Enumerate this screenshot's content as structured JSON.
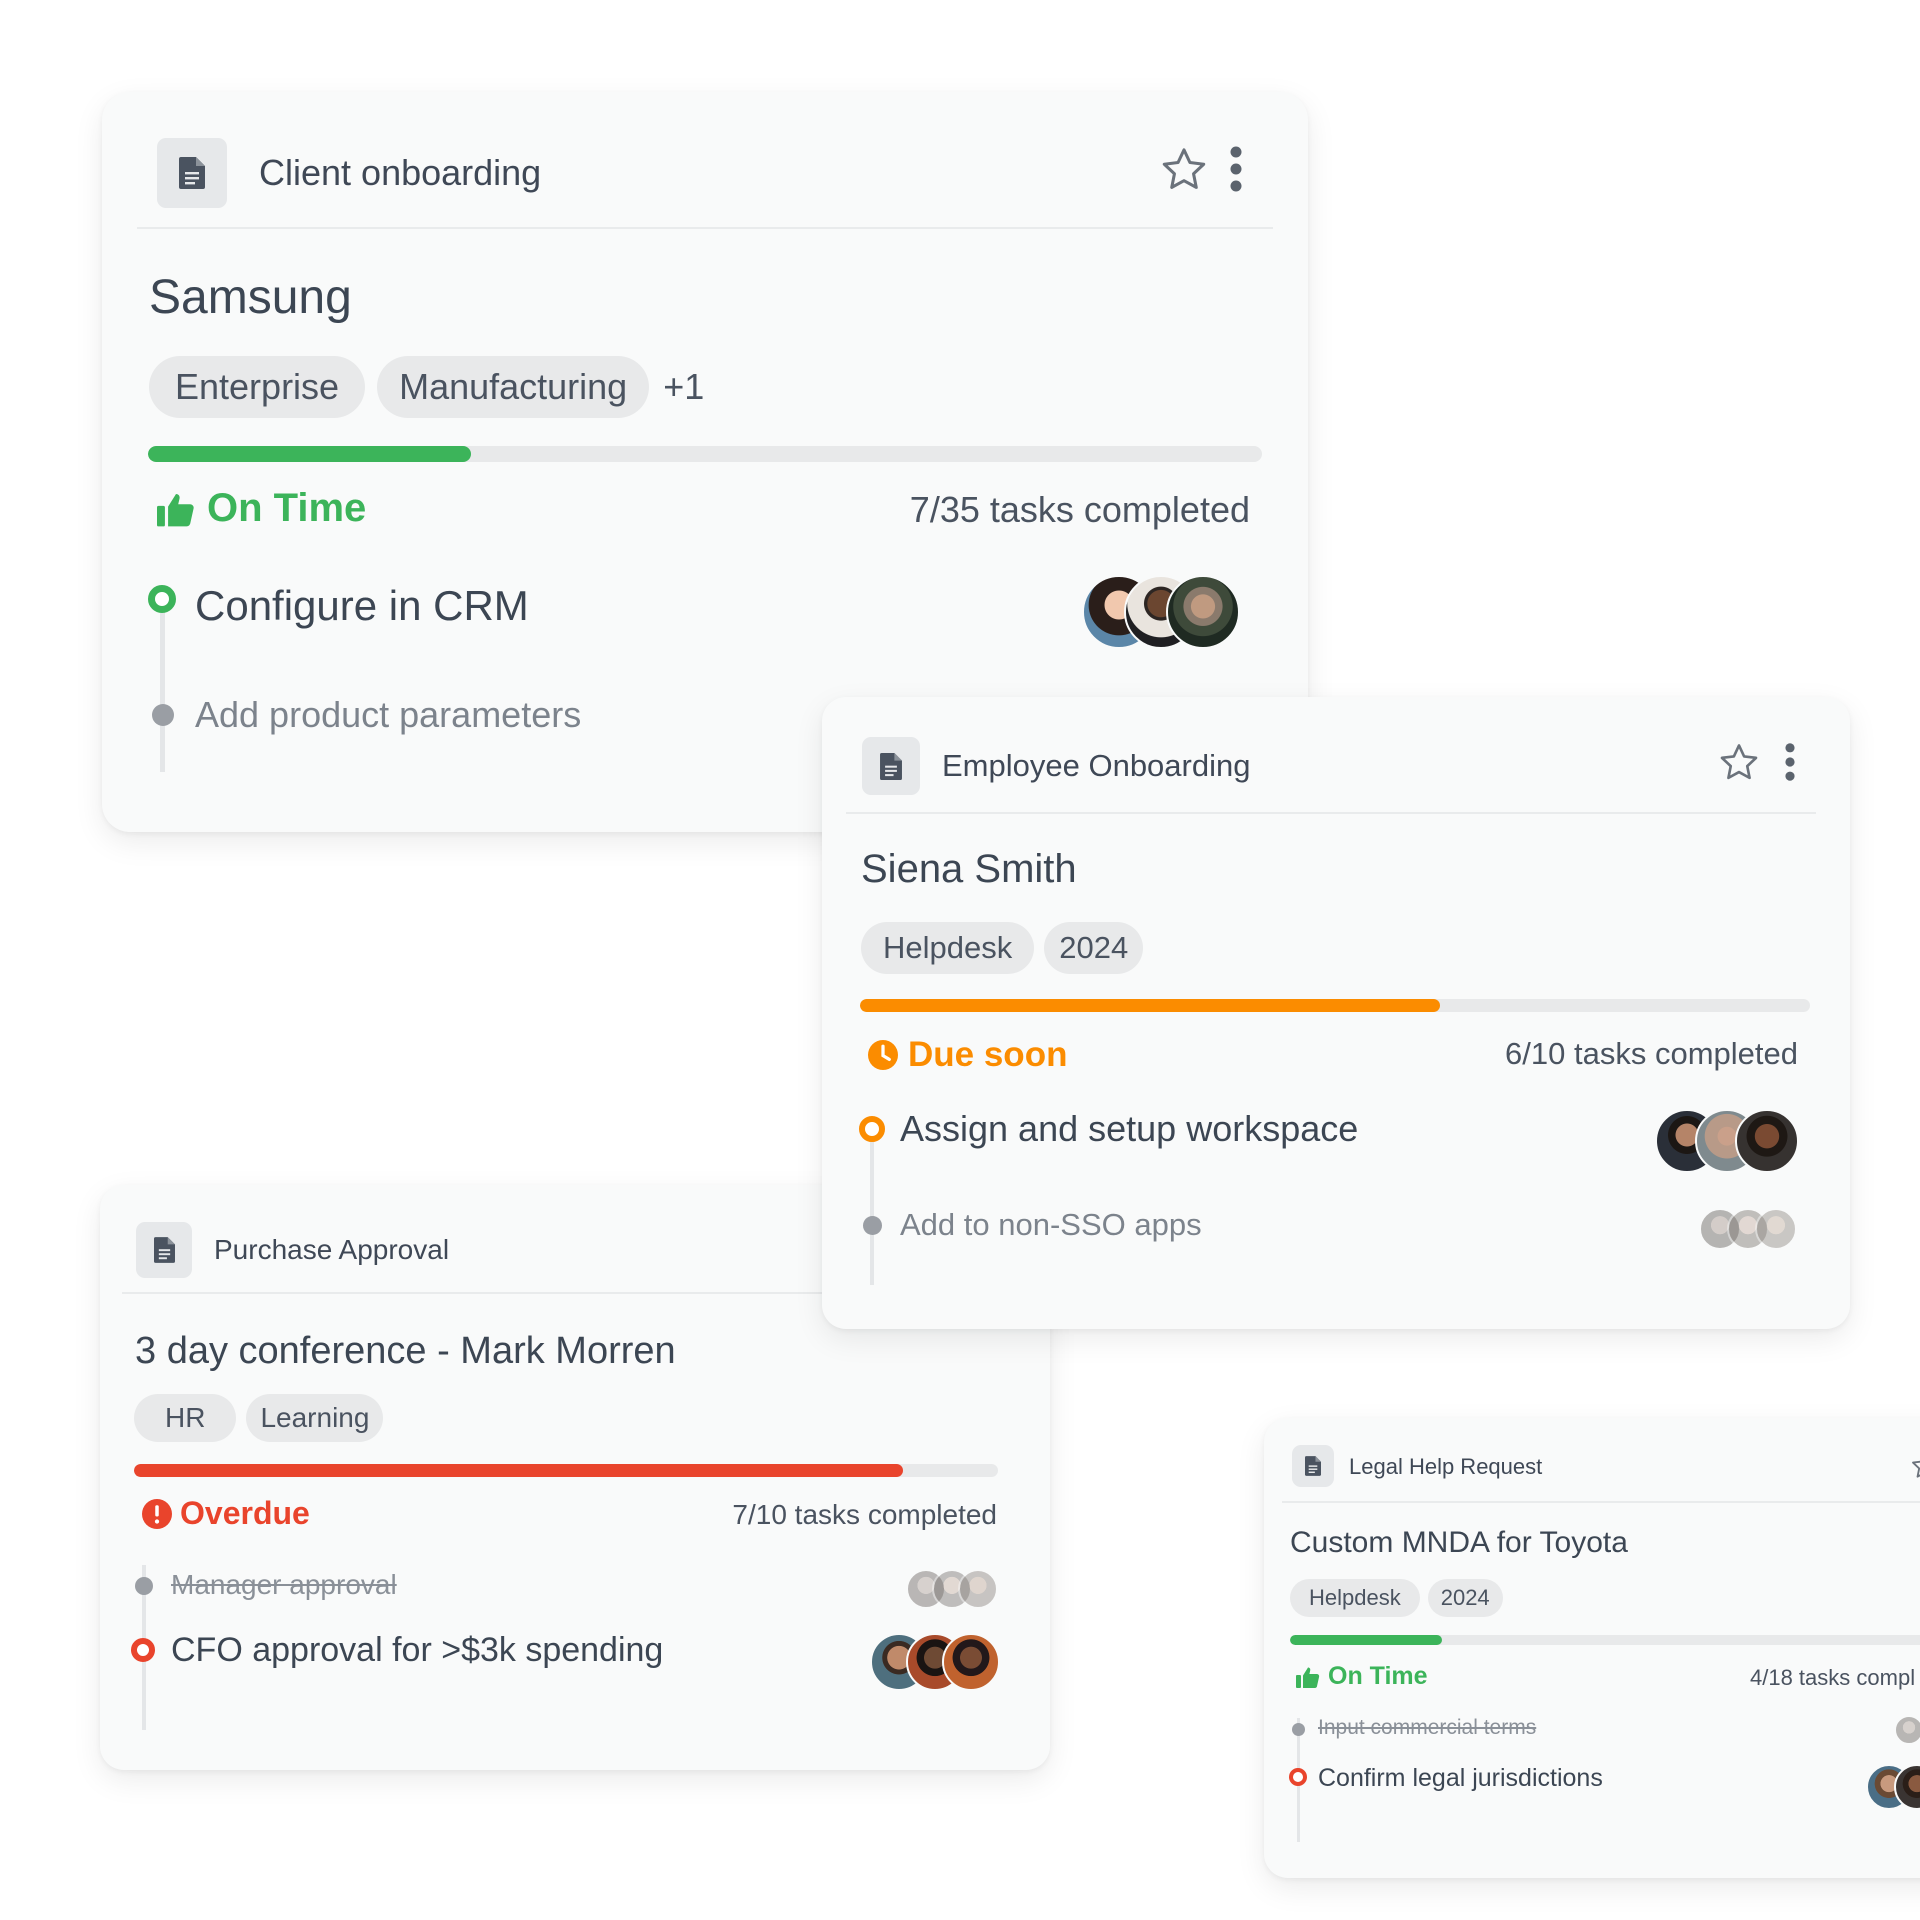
{
  "colors": {
    "green": "#3cb45a",
    "orange": "#fb8c00",
    "red": "#e9442c",
    "track": "#e8e9ea"
  },
  "cards": [
    {
      "type": "Client onboarding",
      "title": "Samsung",
      "tags": [
        "Enterprise",
        "Manufacturing"
      ],
      "more_tags": "+1",
      "progress": 0.2,
      "status": "On Time",
      "status_icon": "thumbs-up-icon",
      "tasks_completed": "7/35 tasks completed",
      "tasks": [
        {
          "label": "Configure in CRM",
          "state": "current",
          "avatars": [
            "woman-smiling",
            "man-suit",
            "man-beard"
          ]
        },
        {
          "label": "Add product parameters",
          "state": "upcoming",
          "avatars": []
        }
      ]
    },
    {
      "type": "Employee Onboarding",
      "title": "Siena Smith",
      "tags": [
        "Helpdesk",
        "2024"
      ],
      "progress": 0.61,
      "status": "Due soon",
      "status_icon": "clock-icon",
      "tasks_completed": "6/10 tasks completed",
      "tasks": [
        {
          "label": "Assign and setup workspace",
          "state": "current",
          "avatars": [
            "man-suit",
            "woman-hijab",
            "man-smiling"
          ]
        },
        {
          "label": "Add to non-SSO apps",
          "state": "upcoming",
          "avatars": [
            "person-1",
            "person-2",
            "person-3"
          ]
        }
      ]
    },
    {
      "type": "Purchase Approval",
      "title": "3 day conference - Mark Morren",
      "tags": [
        "HR",
        "Learning"
      ],
      "progress": 0.89,
      "status": "Overdue",
      "status_icon": "alert-icon",
      "tasks_completed": "7/10 tasks completed",
      "tasks": [
        {
          "label": "Manager approval",
          "state": "done",
          "avatars": [
            "person-1",
            "person-2",
            "person-3"
          ]
        },
        {
          "label": "CFO approval for >$3k spending",
          "state": "current",
          "avatars": [
            "man-1",
            "man-2",
            "woman-1"
          ]
        }
      ]
    },
    {
      "type": "Legal Help Request",
      "title": "Custom MNDA for Toyota",
      "tags": [
        "Helpdesk",
        "2024"
      ],
      "progress": 0.22,
      "status": "On Time",
      "status_icon": "thumbs-up-icon",
      "tasks_completed": "4/18 tasks compl",
      "tasks": [
        {
          "label": "Input commercial terms",
          "state": "done",
          "avatars": [
            "person-1"
          ]
        },
        {
          "label": "Confirm legal jurisdictions",
          "state": "current",
          "avatars": [
            "woman-1",
            "man-1"
          ]
        }
      ]
    }
  ]
}
